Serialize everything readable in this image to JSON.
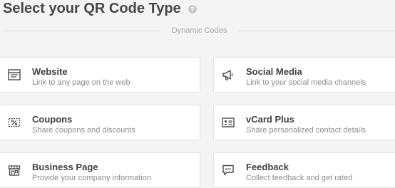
{
  "header": {
    "title": "Select your QR Code Type",
    "help_icon": "question-icon"
  },
  "section": {
    "label": "Dynamic Codes"
  },
  "cards": [
    {
      "name": "Website",
      "desc": "Link to any page on the web",
      "icon": "browser-window-icon"
    },
    {
      "name": "Social Media",
      "desc": "Link to your social media channels",
      "icon": "megaphone-icon"
    },
    {
      "name": "Coupons",
      "desc": "Share coupons and discounts",
      "icon": "coupon-percent-icon"
    },
    {
      "name": "vCard Plus",
      "desc": "Share personalized contact details",
      "icon": "contact-card-icon"
    },
    {
      "name": "Business Page",
      "desc": "Provide your company information",
      "icon": "storefront-icon"
    },
    {
      "name": "Feedback",
      "desc": "Collect feedback and get rated",
      "icon": "chat-bubble-icon"
    }
  ],
  "colors": {
    "background": "#f4f4f4",
    "card": "#ffffff",
    "title": "#474747",
    "icon": "#4a4a4a"
  }
}
